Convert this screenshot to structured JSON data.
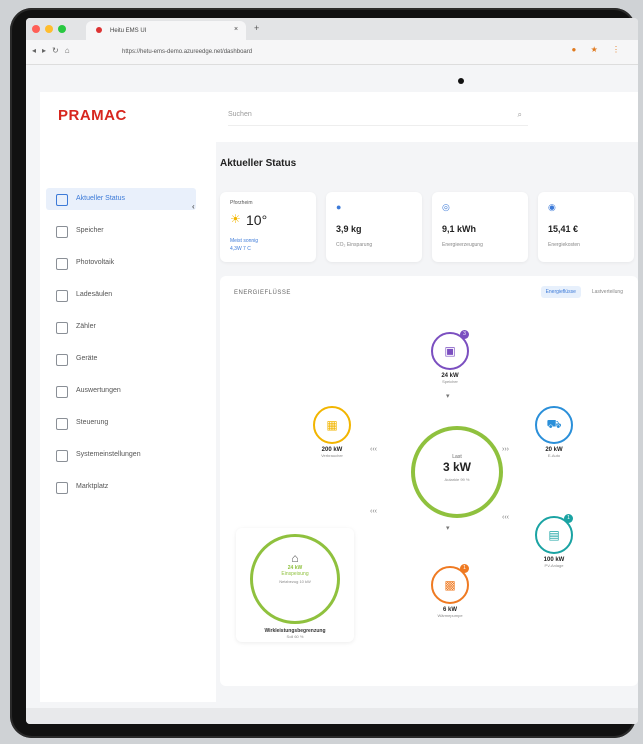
{
  "browser": {
    "tab_title": "Heitu EMS UI",
    "url": "https://hetu-ems-demo.azureedge.net/dashboard"
  },
  "brand": {
    "logo": "PRAMAC",
    "accent": "#d7261e"
  },
  "search": {
    "placeholder": "Suchen"
  },
  "page": {
    "title": "Aktueller Status"
  },
  "sidebar": {
    "items": [
      {
        "label": "Aktueller Status",
        "active": true,
        "icon": "dashboard-icon"
      },
      {
        "label": "Speicher",
        "icon": "battery-icon"
      },
      {
        "label": "Photovoltaik",
        "icon": "solar-icon"
      },
      {
        "label": "Ladesäulen",
        "icon": "charger-icon"
      },
      {
        "label": "Zähler",
        "icon": "meter-icon"
      },
      {
        "label": "Geräte",
        "icon": "device-icon"
      },
      {
        "label": "Auswertungen",
        "icon": "chart-icon"
      },
      {
        "label": "Steuerung",
        "icon": "control-icon"
      },
      {
        "label": "Systemeinstellungen",
        "icon": "settings-icon"
      },
      {
        "label": "Marktplatz",
        "icon": "market-icon"
      }
    ]
  },
  "cards": {
    "weather": {
      "label": "Pforzheim",
      "temp": "10°",
      "sub1": "Meist sonnig",
      "sub2": "4,3W  7 C"
    },
    "co2": {
      "value": "3,9 kg",
      "label": "CO₂ Einsparung"
    },
    "energy": {
      "value": "9,1 kWh",
      "label": "Energieerzeugung"
    },
    "cost": {
      "value": "15,41 €",
      "label": "Energiekosten"
    }
  },
  "flow": {
    "title": "ENERGIEFLÜSSE",
    "tab_active": "Energieflüsse",
    "tab_other": "Lastverteilung",
    "center": {
      "label": "Last",
      "value": "3 kW",
      "sub": "Autarkie 99 %"
    },
    "top": {
      "value": "24 kW",
      "label": "Speicher",
      "badge": "3"
    },
    "left": {
      "value": "200 kW",
      "label": "Verbraucher"
    },
    "right": {
      "value": "20 kW",
      "label": "E-Auto"
    },
    "right_bottom": {
      "value": "100 kW",
      "label": "PV-Anlage",
      "badge": "1"
    },
    "bottom": {
      "value": "6 kW",
      "label": "Wärmepumpe",
      "badge": "1"
    },
    "grid": {
      "v1": "24 kW",
      "v2": "Einspeisung",
      "v3": "Netzbezug 10 kW",
      "label": "Wirkleistungsbegrenzung",
      "sub": "Soll 60 %"
    }
  }
}
